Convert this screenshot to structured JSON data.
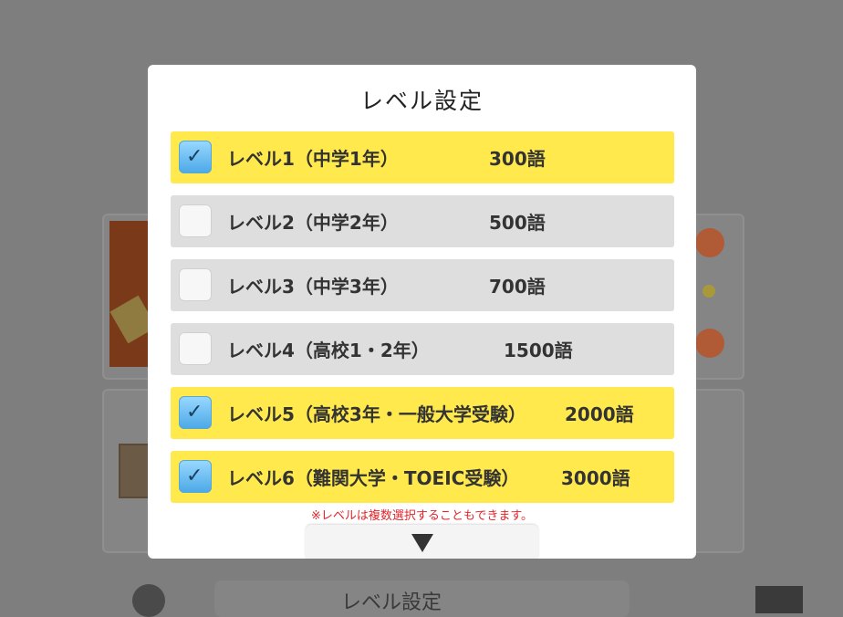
{
  "background": {
    "bottom_text": "レベル設定"
  },
  "modal": {
    "title": "レベル設定",
    "levels": [
      {
        "label": "レベル1（中学1年）",
        "count": "300語",
        "checked": true
      },
      {
        "label": "レベル2（中学2年）",
        "count": "500語",
        "checked": false
      },
      {
        "label": "レベル3（中学3年）",
        "count": "700語",
        "checked": false
      },
      {
        "label": "レベル4（高校1・2年）",
        "count": "1500語",
        "checked": false
      },
      {
        "label": "レベル5（高校3年・一般大学受験）",
        "count": "2000語",
        "checked": true
      },
      {
        "label": "レベル6（難関大学・TOEIC受験）",
        "count": "3000語",
        "checked": true
      }
    ],
    "checkmark": "✓",
    "note": "※レベルは複数選択することもできます。"
  },
  "colors": {
    "checked_row": "#ffe94d",
    "unchecked_row": "#dedede",
    "note_text": "#e0242a",
    "overlay": "#7e7e7e"
  },
  "icons": {
    "scroll": "down-triangle-icon",
    "check": "checkmark-icon"
  }
}
